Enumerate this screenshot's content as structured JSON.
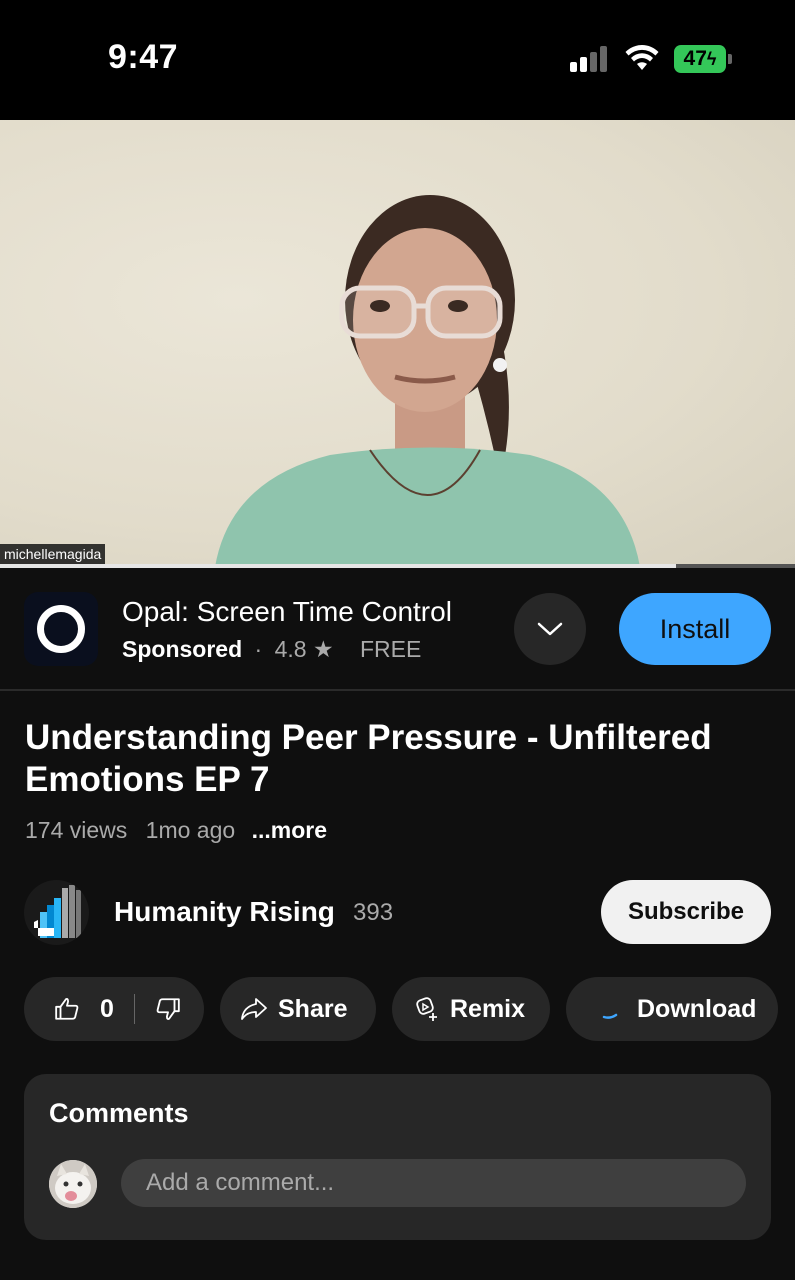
{
  "status_bar": {
    "time": "9:47",
    "battery": "47"
  },
  "video": {
    "overlay_label": "michellemagida",
    "progress_fraction": 0.85
  },
  "ad": {
    "title": "Opal: Screen Time Control",
    "sponsored": "Sponsored",
    "separator": "·",
    "rating": "4.8",
    "star": "★",
    "price": "FREE",
    "install_label": "Install"
  },
  "video_info": {
    "title": "Understanding Peer Pressure - Unfiltered Emotions EP 7",
    "views": "174 views",
    "age": "1mo ago",
    "more": "...more"
  },
  "channel": {
    "name": "Humanity Rising",
    "subscribers": "393",
    "subscribe_label": "Subscribe"
  },
  "actions": {
    "likes": "0",
    "share": "Share",
    "remix": "Remix",
    "download": "Download"
  },
  "comments": {
    "title": "Comments",
    "placeholder": "Add a comment..."
  },
  "colors": {
    "accent": "#3ea6ff",
    "background": "#0f0f0f",
    "battery": "#34c759"
  }
}
